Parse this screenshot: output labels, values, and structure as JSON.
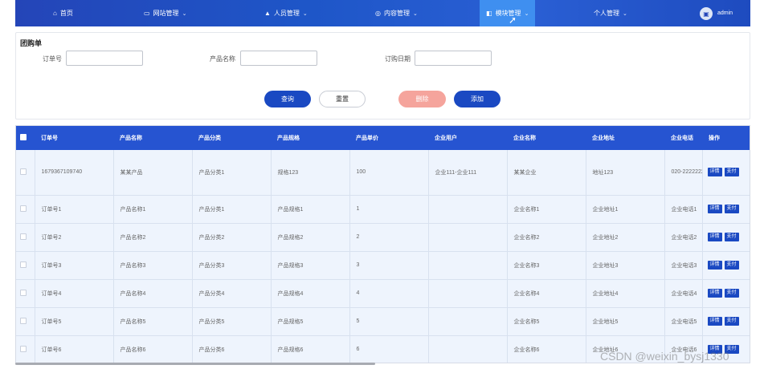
{
  "nav": {
    "items": [
      {
        "label": "首页",
        "icon": "home-icon",
        "glyph": "⌂",
        "chevron": false
      },
      {
        "label": "网站管理",
        "icon": "monitor-icon",
        "glyph": "▭",
        "chevron": true
      },
      {
        "label": "人员管理",
        "icon": "user-icon",
        "glyph": "▲",
        "chevron": true
      },
      {
        "label": "内容管理",
        "icon": "content-icon",
        "glyph": "◎",
        "chevron": true
      },
      {
        "label": "模块管理",
        "icon": "module-icon",
        "glyph": "◧",
        "chevron": true
      },
      {
        "label": "个人管理",
        "icon": "",
        "glyph": "",
        "chevron": true
      }
    ],
    "active_index": 4,
    "user_name": "admin"
  },
  "search": {
    "title": "团购单",
    "fields": [
      {
        "label": "订单号",
        "value": ""
      },
      {
        "label": "产品名称",
        "value": ""
      },
      {
        "label": "订购日期",
        "value": ""
      }
    ],
    "buttons": {
      "query": "查询",
      "reset": "重置",
      "delete": "删除",
      "add": "添加"
    }
  },
  "table": {
    "columns": [
      "订单号",
      "产品名称",
      "产品分类",
      "产品规格",
      "产品单价",
      "企业用户",
      "企业名称",
      "企业地址",
      "企业电话",
      "操作"
    ],
    "rows": [
      [
        "1679367109740",
        "某某产品",
        "产品分类1",
        "规格123",
        "100",
        "企业111-企业111",
        "某某企业",
        "地址123",
        "020-2222222"
      ],
      [
        "订单号1",
        "产品名称1",
        "产品分类1",
        "产品规格1",
        "1",
        "",
        "企业名称1",
        "企业地址1",
        "企业电话1"
      ],
      [
        "订单号2",
        "产品名称2",
        "产品分类2",
        "产品规格2",
        "2",
        "",
        "企业名称2",
        "企业地址2",
        "企业电话2"
      ],
      [
        "订单号3",
        "产品名称3",
        "产品分类3",
        "产品规格3",
        "3",
        "",
        "企业名称3",
        "企业地址3",
        "企业电话3"
      ],
      [
        "订单号4",
        "产品名称4",
        "产品分类4",
        "产品规格4",
        "4",
        "",
        "企业名称4",
        "企业地址4",
        "企业电话4"
      ],
      [
        "订单号5",
        "产品名称5",
        "产品分类5",
        "产品规格5",
        "5",
        "",
        "企业名称5",
        "企业地址5",
        "企业电话5"
      ],
      [
        "订单号6",
        "产品名称6",
        "产品分类6",
        "产品规格6",
        "6",
        "",
        "企业名称6",
        "企业地址6",
        "企业电话6"
      ]
    ],
    "row_actions": [
      "详情",
      "支付"
    ]
  },
  "watermark": "CSDN @weixin_bysj1330",
  "colors": {
    "nav": "#2445b8",
    "nav_active": "#3f8ff0",
    "primary": "#1a49c2",
    "danger": "#f5a49c",
    "header": "#2654d1"
  }
}
